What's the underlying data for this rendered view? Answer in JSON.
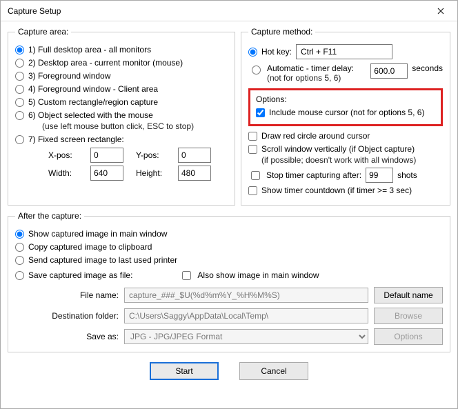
{
  "window": {
    "title": "Capture Setup"
  },
  "area": {
    "legend": "Capture area:",
    "opt1": "1) Full desktop area - all monitors",
    "opt2": "2) Desktop area - current monitor (mouse)",
    "opt3": "3) Foreground window",
    "opt4": "4) Foreground window - Client area",
    "opt5": "5) Custom rectangle/region capture",
    "opt6": "6) Object selected with the mouse",
    "opt6b": "(use left mouse button click, ESC to stop)",
    "opt7": "7) Fixed screen rectangle:",
    "xpos_label": "X-pos:",
    "xpos": "0",
    "ypos_label": "Y-pos:",
    "ypos": "0",
    "width_label": "Width:",
    "width": "640",
    "height_label": "Height:",
    "height": "480"
  },
  "method": {
    "legend": "Capture method:",
    "hotkey_label": "Hot key:",
    "hotkey_value": "Ctrl + F11",
    "auto_label": "Automatic - timer delay:",
    "auto_sub": "(not for options 5, 6)",
    "auto_value": "600.0",
    "seconds": "seconds"
  },
  "options": {
    "title": "Options:",
    "include_cursor": "Include mouse cursor (not for options 5, 6)",
    "red_circle": "Draw red circle around cursor",
    "scroll": "Scroll window vertically (if Object capture)",
    "scroll_sub": "(if possible; doesn't work with all windows)",
    "stop_after": "Stop timer capturing after:",
    "stop_value": "99",
    "shots": "shots",
    "countdown": "Show timer countdown (if timer >= 3 sec)"
  },
  "after": {
    "legend": "After the capture:",
    "show_main": "Show captured image in main window",
    "copy_clip": "Copy captured image to clipboard",
    "send_printer": "Send captured image to last used printer",
    "save_file": "Save captured image as file:",
    "also_show": "Also show image in main window",
    "fname_label": "File name:",
    "fname_value": "capture_###_$U(%d%m%Y_%H%M%S)",
    "default_btn": "Default name",
    "folder_label": "Destination folder:",
    "folder_value": "C:\\Users\\Saggy\\AppData\\Local\\Temp\\",
    "browse": "Browse",
    "saveas_label": "Save as:",
    "saveas_value": "JPG - JPG/JPEG Format",
    "options_btn": "Options"
  },
  "footer": {
    "start": "Start",
    "cancel": "Cancel"
  }
}
